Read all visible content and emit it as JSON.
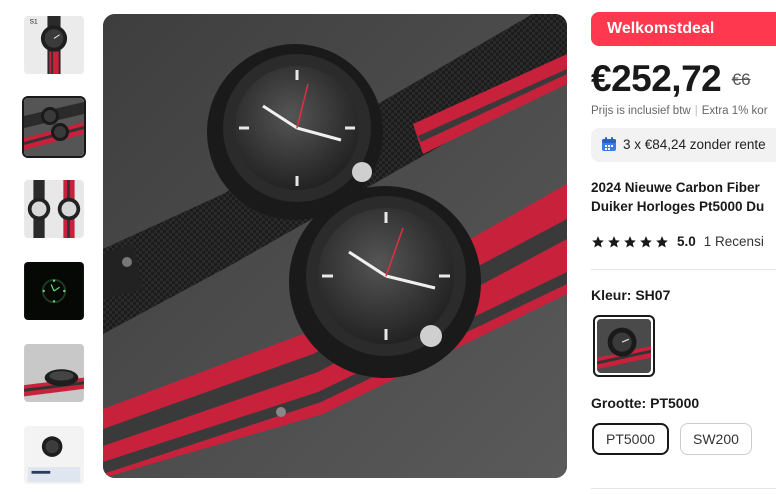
{
  "thumbnails": [
    {
      "name": "thumb-single-watch"
    },
    {
      "name": "thumb-two-watches",
      "selected": true
    },
    {
      "name": "thumb-watch-backs"
    },
    {
      "name": "thumb-lume-dark"
    },
    {
      "name": "thumb-watch-side"
    },
    {
      "name": "thumb-watch-box"
    }
  ],
  "main_image": {
    "alt": "two carbon diver watches"
  },
  "deal": {
    "label": "Welkomstdeal"
  },
  "price": {
    "current": "€252,72",
    "original": "€6"
  },
  "vat": {
    "text": "Prijs is inclusief btw",
    "extra": "Extra 1% kor"
  },
  "installment": {
    "text": "3 x €84,24 zonder rente"
  },
  "product": {
    "title_line1": "2024 Nieuwe Carbon Fiber",
    "title_line2": "Duiker Horloges Pt5000 Du"
  },
  "rating": {
    "score": "5.0",
    "reviews": "1 Recensi",
    "stars": 5
  },
  "color": {
    "label": "Kleur: SH07"
  },
  "size": {
    "label": "Grootte: PT5000",
    "options": [
      "PT5000",
      "SW200"
    ],
    "selected": "PT5000"
  },
  "colors": {
    "accent": "#fd384f",
    "text": "#191919",
    "muted": "#666666"
  }
}
